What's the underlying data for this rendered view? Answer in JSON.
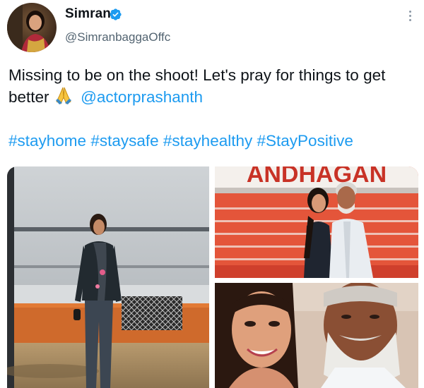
{
  "author": {
    "display_name": "Simran",
    "handle": "@SimranbaggaOffc",
    "verified": true,
    "avatar_icon": "profile-photo"
  },
  "tweet": {
    "text_before": "Missing to be on the shoot! Let's pray for things to get better",
    "emoji": "folded-hands",
    "mention": "@actorprashanth",
    "hashtags": [
      "#stayhome",
      "#staysafe",
      "#stayhealthy",
      "#StayPositive"
    ]
  },
  "media": {
    "photos": [
      {
        "description_icon": "woman-standing-by-caravan-photo"
      },
      {
        "description_icon": "two-people-before-banner-photo",
        "banner_text": "ANDHAGAN"
      },
      {
        "description_icon": "selfie-photo"
      }
    ]
  },
  "colors": {
    "link": "#1d9bf0",
    "verified": "#1d9bf0",
    "text": "#0f1419",
    "secondary_text": "#536471"
  }
}
